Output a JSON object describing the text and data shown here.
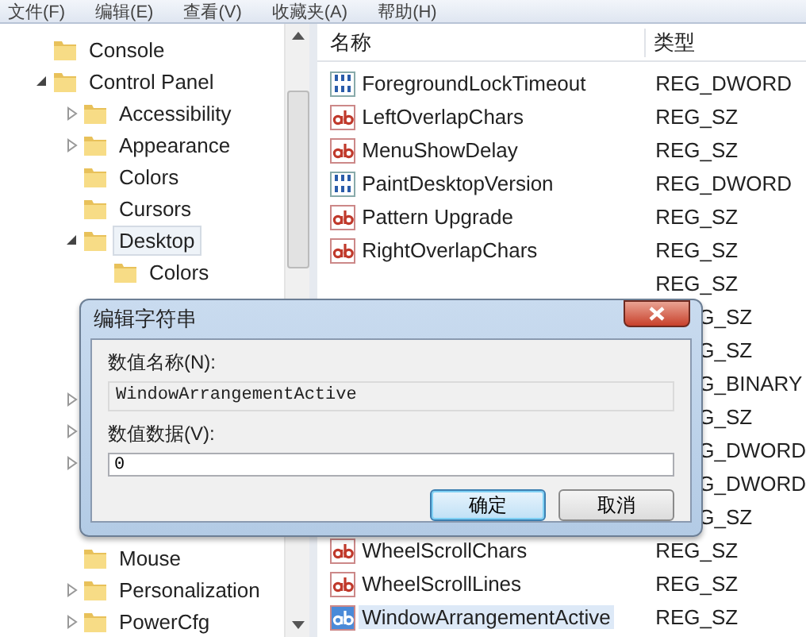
{
  "menu": [
    "文件(F)",
    "编辑(E)",
    "查看(V)",
    "收藏夹(A)",
    "帮助(H)"
  ],
  "tree": [
    {
      "label": "Console",
      "selected": false
    },
    {
      "label": "Control Panel",
      "selected": false,
      "expanded": true,
      "children": [
        {
          "label": "Accessibility",
          "selected": false,
          "expanded": false
        },
        {
          "label": "Appearance",
          "selected": false,
          "expanded": false
        },
        {
          "label": "Colors",
          "selected": false
        },
        {
          "label": "Cursors",
          "selected": false
        },
        {
          "label": "Desktop",
          "selected": true,
          "expanded": true,
          "children": [
            {
              "label": "Colors",
              "selected": false
            }
          ]
        },
        {
          "covered": true
        },
        {
          "covered": true
        },
        {
          "covered": true
        },
        {
          "covered": true,
          "expanded": false
        },
        {
          "covered": true,
          "expanded": false
        },
        {
          "covered": true,
          "expanded": false
        },
        {
          "covered": true
        },
        {
          "covered": true
        },
        {
          "label": "Mouse",
          "selected": false
        },
        {
          "label": "Personalization",
          "selected": false,
          "expanded": false
        },
        {
          "label": "PowerCfg",
          "selected": false,
          "expanded": false
        }
      ]
    }
  ],
  "columns": [
    "名称",
    "类型"
  ],
  "rows": [
    {
      "name": "ForegroundLockTimeout",
      "type": "REG_DWORD",
      "kind": "binary",
      "selected": false,
      "covered": false
    },
    {
      "name": "LeftOverlapChars",
      "type": "REG_SZ",
      "kind": "string",
      "selected": false,
      "covered": false
    },
    {
      "name": "MenuShowDelay",
      "type": "REG_SZ",
      "kind": "string",
      "selected": false,
      "covered": false
    },
    {
      "name": "PaintDesktopVersion",
      "type": "REG_DWORD",
      "kind": "binary",
      "selected": false,
      "covered": false
    },
    {
      "name": "Pattern Upgrade",
      "type": "REG_SZ",
      "kind": "string",
      "selected": false,
      "covered": false
    },
    {
      "name": "RightOverlapChars",
      "type": "REG_SZ",
      "kind": "string",
      "selected": false,
      "covered": false
    },
    {
      "type": "REG_SZ",
      "covered": false
    },
    {
      "type": "G_SZ",
      "covered": true
    },
    {
      "type": "G_SZ",
      "covered": true
    },
    {
      "type": "G_BINARY",
      "covered": true
    },
    {
      "type": "G_SZ",
      "covered": true
    },
    {
      "type": "G_DWORD",
      "covered": true
    },
    {
      "type": "G_DWORD",
      "covered": true
    },
    {
      "type": "G_SZ",
      "covered": true
    },
    {
      "name": "WheelScrollChars",
      "type": "REG_SZ",
      "kind": "string",
      "selected": false,
      "covered": false
    },
    {
      "name": "WheelScrollLines",
      "type": "REG_SZ",
      "kind": "string",
      "selected": false,
      "covered": false
    },
    {
      "name": "WindowArrangementActive",
      "type": "REG_SZ",
      "kind": "string",
      "selected": true,
      "covered": false
    }
  ],
  "dialog": {
    "title": "编辑字符串",
    "name_label": "数值名称(N):",
    "name_value": "WindowArrangementActive",
    "data_label": "数值数据(V):",
    "data_value": "0",
    "buttons": [
      {
        "label": "确定",
        "default": true
      },
      {
        "label": "取消",
        "default": false
      }
    ]
  }
}
